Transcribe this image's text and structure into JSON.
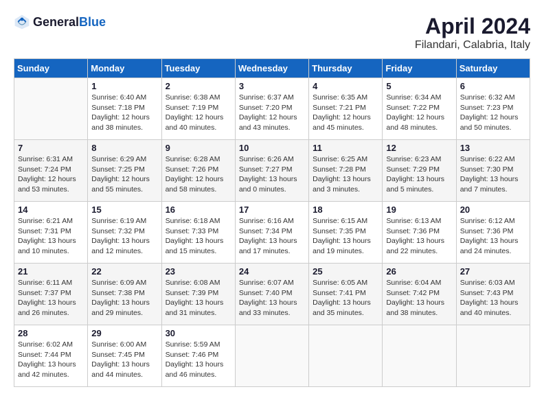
{
  "header": {
    "logo_general": "General",
    "logo_blue": "Blue",
    "title": "April 2024",
    "location": "Filandari, Calabria, Italy"
  },
  "calendar": {
    "days_of_week": [
      "Sunday",
      "Monday",
      "Tuesday",
      "Wednesday",
      "Thursday",
      "Friday",
      "Saturday"
    ],
    "weeks": [
      [
        {
          "day": "",
          "info": ""
        },
        {
          "day": "1",
          "info": "Sunrise: 6:40 AM\nSunset: 7:18 PM\nDaylight: 12 hours\nand 38 minutes."
        },
        {
          "day": "2",
          "info": "Sunrise: 6:38 AM\nSunset: 7:19 PM\nDaylight: 12 hours\nand 40 minutes."
        },
        {
          "day": "3",
          "info": "Sunrise: 6:37 AM\nSunset: 7:20 PM\nDaylight: 12 hours\nand 43 minutes."
        },
        {
          "day": "4",
          "info": "Sunrise: 6:35 AM\nSunset: 7:21 PM\nDaylight: 12 hours\nand 45 minutes."
        },
        {
          "day": "5",
          "info": "Sunrise: 6:34 AM\nSunset: 7:22 PM\nDaylight: 12 hours\nand 48 minutes."
        },
        {
          "day": "6",
          "info": "Sunrise: 6:32 AM\nSunset: 7:23 PM\nDaylight: 12 hours\nand 50 minutes."
        }
      ],
      [
        {
          "day": "7",
          "info": "Sunrise: 6:31 AM\nSunset: 7:24 PM\nDaylight: 12 hours\nand 53 minutes."
        },
        {
          "day": "8",
          "info": "Sunrise: 6:29 AM\nSunset: 7:25 PM\nDaylight: 12 hours\nand 55 minutes."
        },
        {
          "day": "9",
          "info": "Sunrise: 6:28 AM\nSunset: 7:26 PM\nDaylight: 12 hours\nand 58 minutes."
        },
        {
          "day": "10",
          "info": "Sunrise: 6:26 AM\nSunset: 7:27 PM\nDaylight: 13 hours\nand 0 minutes."
        },
        {
          "day": "11",
          "info": "Sunrise: 6:25 AM\nSunset: 7:28 PM\nDaylight: 13 hours\nand 3 minutes."
        },
        {
          "day": "12",
          "info": "Sunrise: 6:23 AM\nSunset: 7:29 PM\nDaylight: 13 hours\nand 5 minutes."
        },
        {
          "day": "13",
          "info": "Sunrise: 6:22 AM\nSunset: 7:30 PM\nDaylight: 13 hours\nand 7 minutes."
        }
      ],
      [
        {
          "day": "14",
          "info": "Sunrise: 6:21 AM\nSunset: 7:31 PM\nDaylight: 13 hours\nand 10 minutes."
        },
        {
          "day": "15",
          "info": "Sunrise: 6:19 AM\nSunset: 7:32 PM\nDaylight: 13 hours\nand 12 minutes."
        },
        {
          "day": "16",
          "info": "Sunrise: 6:18 AM\nSunset: 7:33 PM\nDaylight: 13 hours\nand 15 minutes."
        },
        {
          "day": "17",
          "info": "Sunrise: 6:16 AM\nSunset: 7:34 PM\nDaylight: 13 hours\nand 17 minutes."
        },
        {
          "day": "18",
          "info": "Sunrise: 6:15 AM\nSunset: 7:35 PM\nDaylight: 13 hours\nand 19 minutes."
        },
        {
          "day": "19",
          "info": "Sunrise: 6:13 AM\nSunset: 7:36 PM\nDaylight: 13 hours\nand 22 minutes."
        },
        {
          "day": "20",
          "info": "Sunrise: 6:12 AM\nSunset: 7:36 PM\nDaylight: 13 hours\nand 24 minutes."
        }
      ],
      [
        {
          "day": "21",
          "info": "Sunrise: 6:11 AM\nSunset: 7:37 PM\nDaylight: 13 hours\nand 26 minutes."
        },
        {
          "day": "22",
          "info": "Sunrise: 6:09 AM\nSunset: 7:38 PM\nDaylight: 13 hours\nand 29 minutes."
        },
        {
          "day": "23",
          "info": "Sunrise: 6:08 AM\nSunset: 7:39 PM\nDaylight: 13 hours\nand 31 minutes."
        },
        {
          "day": "24",
          "info": "Sunrise: 6:07 AM\nSunset: 7:40 PM\nDaylight: 13 hours\nand 33 minutes."
        },
        {
          "day": "25",
          "info": "Sunrise: 6:05 AM\nSunset: 7:41 PM\nDaylight: 13 hours\nand 35 minutes."
        },
        {
          "day": "26",
          "info": "Sunrise: 6:04 AM\nSunset: 7:42 PM\nDaylight: 13 hours\nand 38 minutes."
        },
        {
          "day": "27",
          "info": "Sunrise: 6:03 AM\nSunset: 7:43 PM\nDaylight: 13 hours\nand 40 minutes."
        }
      ],
      [
        {
          "day": "28",
          "info": "Sunrise: 6:02 AM\nSunset: 7:44 PM\nDaylight: 13 hours\nand 42 minutes."
        },
        {
          "day": "29",
          "info": "Sunrise: 6:00 AM\nSunset: 7:45 PM\nDaylight: 13 hours\nand 44 minutes."
        },
        {
          "day": "30",
          "info": "Sunrise: 5:59 AM\nSunset: 7:46 PM\nDaylight: 13 hours\nand 46 minutes."
        },
        {
          "day": "",
          "info": ""
        },
        {
          "day": "",
          "info": ""
        },
        {
          "day": "",
          "info": ""
        },
        {
          "day": "",
          "info": ""
        }
      ]
    ]
  }
}
